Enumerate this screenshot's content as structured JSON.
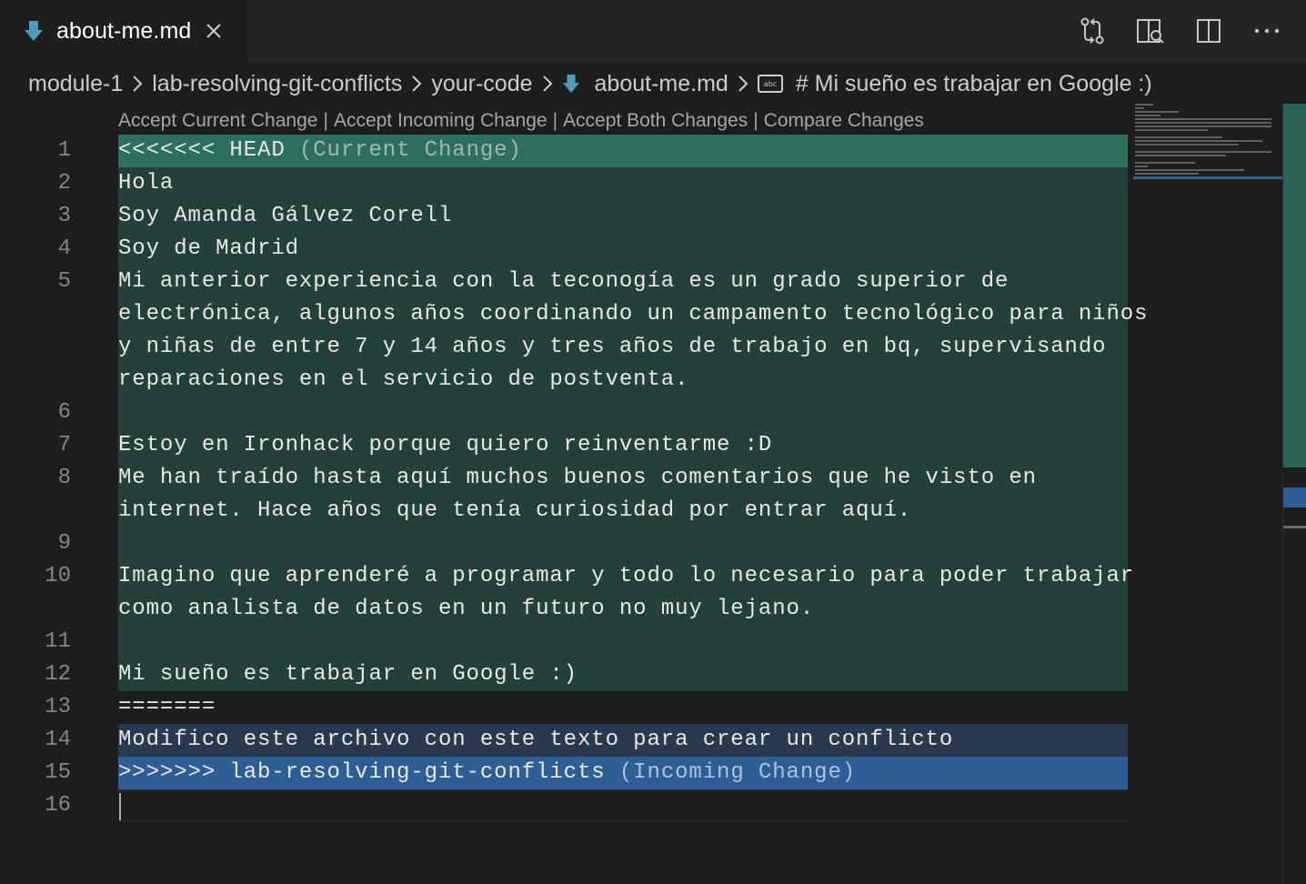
{
  "tab": {
    "label": "about-me.md",
    "file_icon": "markdown-arrow-icon",
    "close_icon": "close-icon"
  },
  "actions": [
    {
      "name": "open-changes-icon"
    },
    {
      "name": "open-preview-to-side-icon"
    },
    {
      "name": "split-editor-icon"
    },
    {
      "name": "more-actions-icon"
    }
  ],
  "breadcrumb": {
    "items": [
      "module-1",
      "lab-resolving-git-conflicts",
      "your-code",
      "about-me.md",
      "# Mi sueño es trabajar en Google :)"
    ]
  },
  "codelens": {
    "accept_current": "Accept Current Change",
    "accept_incoming": "Accept Incoming Change",
    "accept_both": "Accept Both Changes",
    "compare": "Compare Changes",
    "separator": "|"
  },
  "conflict": {
    "current_marker": "<<<<<<< HEAD",
    "current_label": "(Current Change)",
    "separator_marker": "=======",
    "incoming_marker": ">>>>>>> lab-resolving-git-conflicts",
    "incoming_label": "(Incoming Change)"
  },
  "line_numbers": [
    "1",
    "2",
    "3",
    "4",
    "5",
    "6",
    "7",
    "8",
    "9",
    "10",
    "11",
    "12",
    "13",
    "14",
    "15",
    "16"
  ],
  "code": {
    "l2": "Hola",
    "l3": "Soy Amanda Gálvez Corell",
    "l4": "Soy de Madrid",
    "l5a": "Mi anterior experiencia con la teconogía es un grado superior de",
    "l5b": "electrónica, algunos años coordinando un campamento tecnológico para niños",
    "l5c": "y niñas de entre 7 y 14 años y tres años de trabajo en bq, supervisando",
    "l5d": "reparaciones en el servicio de postventa.",
    "l7": "Estoy en Ironhack porque quiero reinventarme :D",
    "l8a": "Me han traído hasta aquí muchos buenos comentarios que he visto en",
    "l8b": "internet. Hace años que tenía curiosidad por entrar aquí.",
    "l10a": "Imagino que aprenderé a programar y todo lo necesario para poder trabajar",
    "l10b": "como analista de datos en un futuro no muy lejano.",
    "l12": "Mi sueño es trabajar en Google :)",
    "l14": "Modifico este archivo con este texto para crear un conflicto"
  },
  "colors": {
    "current_header": "#2d6f5e",
    "current_body": "#23403a",
    "incoming_header": "#2e5f94",
    "incoming_body": "#293a50",
    "editor_bg": "#1e1e1e",
    "md_icon": "#519aba"
  }
}
